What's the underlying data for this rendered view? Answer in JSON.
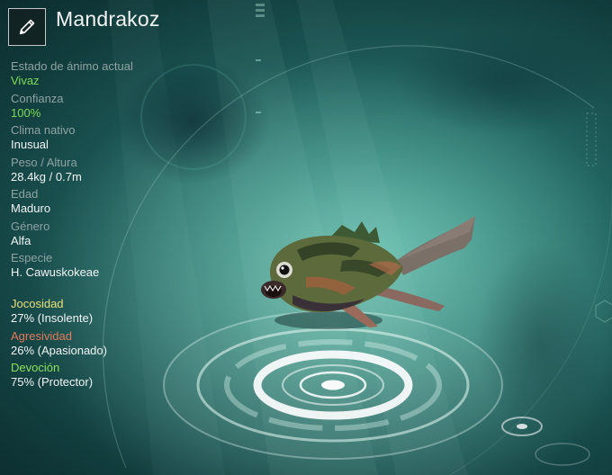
{
  "header": {
    "title": "Mandrakoz",
    "edit_icon": "pencil-icon"
  },
  "stats": [
    {
      "label": "Estado de ánimo actual",
      "value": "Vivaz",
      "highlight": true
    },
    {
      "label": "Confianza",
      "value": "100%",
      "highlight": true
    },
    {
      "label": "Clima nativo",
      "value": "Inusual",
      "highlight": false
    },
    {
      "label": "Peso / Altura",
      "value": "28.4kg / 0.7m",
      "highlight": false
    },
    {
      "label": "Edad",
      "value": "Maduro",
      "highlight": false
    },
    {
      "label": "Género",
      "value": "Alfa",
      "highlight": false
    },
    {
      "label": "Especie",
      "value": "H. Cawuskokeae",
      "highlight": false
    }
  ],
  "traits": [
    {
      "label": "Jocosidad",
      "value": "27% (Insolente)",
      "color": "#e8e07a"
    },
    {
      "label": "Agresividad",
      "value": "26% (Apasionado)",
      "color": "#e27a5a"
    },
    {
      "label": "Devoción",
      "value": "75% (Protector)",
      "color": "#8ee05a"
    }
  ],
  "colors": {
    "accent_green": "#7ed957",
    "label_gray": "#8fa3a1",
    "text_white": "#f2f4f4",
    "background_teal": "#2d7e76"
  }
}
